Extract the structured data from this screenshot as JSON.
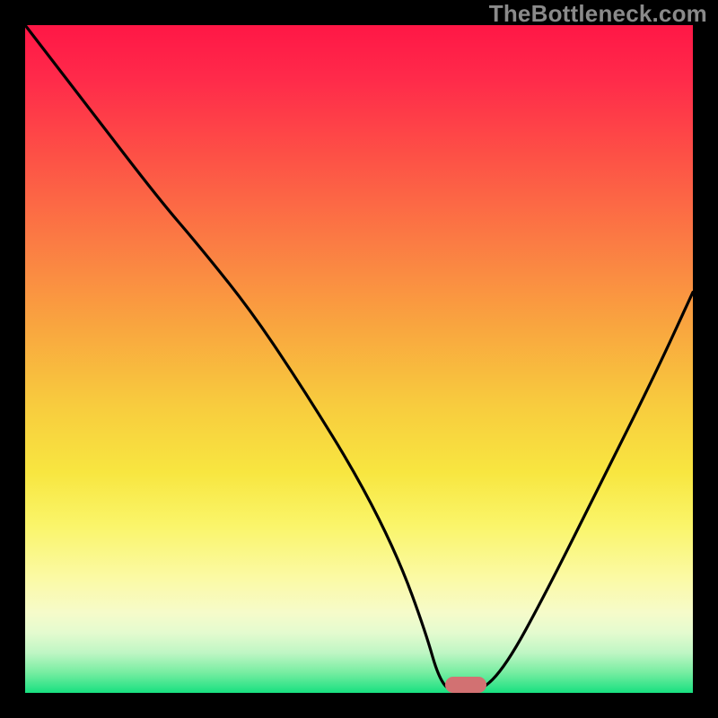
{
  "watermark": "TheBottleneck.com",
  "chart_data": {
    "type": "line",
    "title": "",
    "xlabel": "",
    "ylabel": "",
    "xlim": [
      0,
      100
    ],
    "ylim": [
      0,
      100
    ],
    "series": [
      {
        "name": "bottleneck-curve",
        "x": [
          0,
          10,
          20,
          26,
          34,
          42,
          50,
          56,
          60,
          62,
          64,
          68,
          72,
          78,
          86,
          94,
          100
        ],
        "values": [
          100,
          87,
          74,
          67,
          57,
          45,
          32,
          20,
          9,
          2,
          0,
          0,
          4,
          15,
          31,
          47,
          60
        ]
      }
    ],
    "marker": {
      "x": 66,
      "y": 0
    },
    "gradient_stops": [
      {
        "pos": 0,
        "color": "#ff1746"
      },
      {
        "pos": 20,
        "color": "#fd5246"
      },
      {
        "pos": 45,
        "color": "#f9a53f"
      },
      {
        "pos": 67,
        "color": "#f8e640"
      },
      {
        "pos": 88,
        "color": "#f6fbca"
      },
      {
        "pos": 100,
        "color": "#18e080"
      }
    ]
  },
  "colors": {
    "curve": "#000000",
    "marker": "#d27172",
    "watermark": "#8a8a8a",
    "frame": "#000000"
  }
}
